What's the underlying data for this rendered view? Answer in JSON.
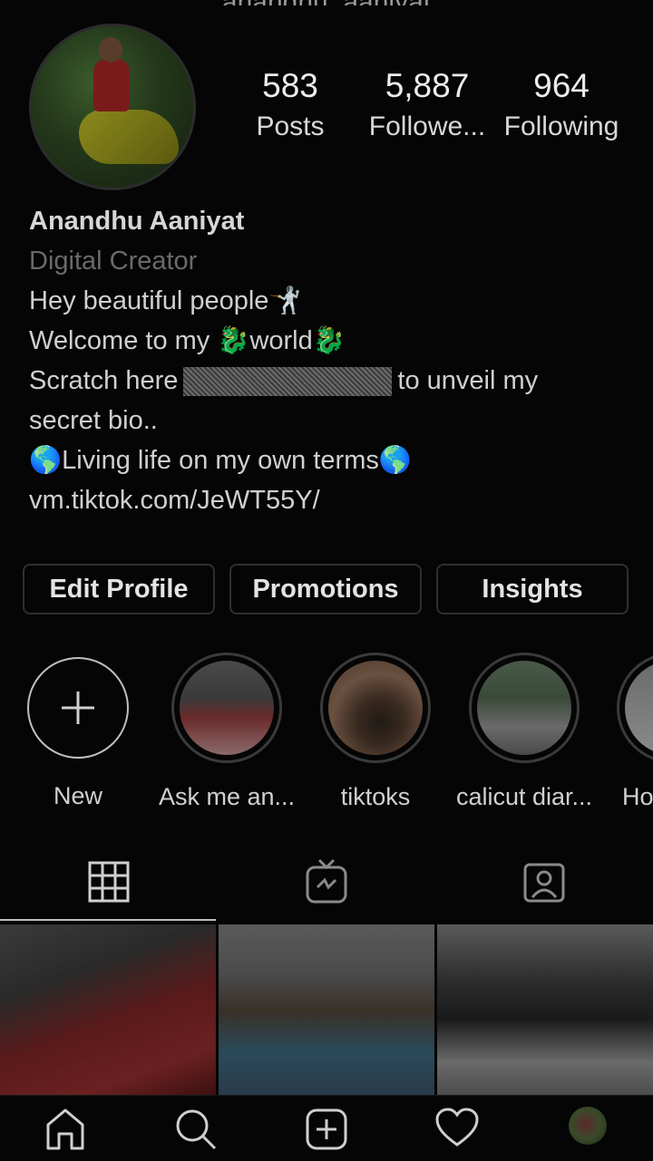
{
  "header": {
    "title": "anandhu_aaniyat"
  },
  "profile": {
    "stats": [
      {
        "value": "583",
        "label": "Posts"
      },
      {
        "value": "5,887",
        "label": "Followe..."
      },
      {
        "value": "964",
        "label": "Following"
      }
    ],
    "name": "Anandhu Aaniyat",
    "category": "Digital Creator",
    "bio_line1": "Hey beautiful people🤺",
    "bio_line2": "Welcome to my 🐉world🐉",
    "bio_line3_a": "Scratch here",
    "bio_line3_b": "to unveil my",
    "bio_line4": "secret bio..",
    "bio_line5": "🌎Living life on my own terms🌎",
    "link": "vm.tiktok.com/JeWT55Y/"
  },
  "actions": {
    "edit_profile": "Edit Profile",
    "promotions": "Promotions",
    "insights": "Insights"
  },
  "highlights": [
    {
      "label": "New"
    },
    {
      "label": "Ask me an..."
    },
    {
      "label": "tiktoks"
    },
    {
      "label": "calicut diar..."
    },
    {
      "label": "Ho"
    }
  ],
  "tabs": [
    "grid-icon",
    "igtv-icon",
    "tagged-icon"
  ],
  "nav": [
    "home-icon",
    "search-icon",
    "add-post-icon",
    "activity-heart-icon",
    "profile-avatar"
  ],
  "colors": {
    "background": "#050505",
    "text": "#e6e6e6",
    "muted": "#6a6a6a"
  }
}
